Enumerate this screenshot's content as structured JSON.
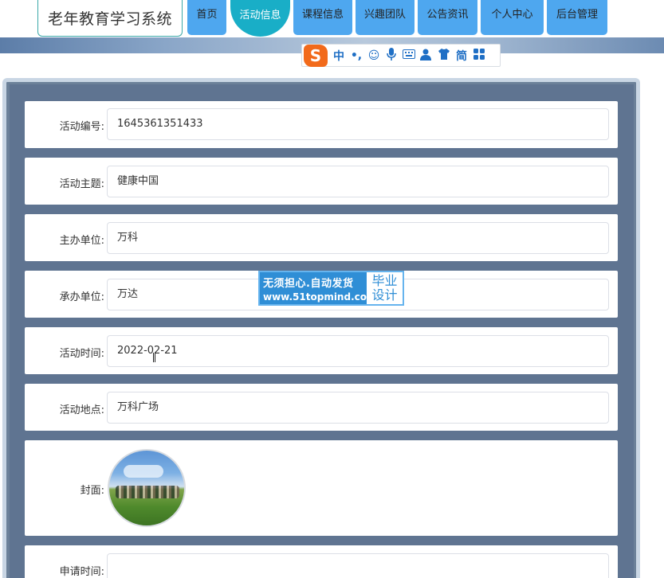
{
  "header": {
    "logo_text": "老年教育学习系统",
    "nav": [
      {
        "label": "首页"
      },
      {
        "label": "活动信息"
      },
      {
        "label": "课程信息"
      },
      {
        "label": "兴趣团队"
      },
      {
        "label": "公告资讯"
      },
      {
        "label": "个人中心"
      },
      {
        "label": "后台管理"
      }
    ]
  },
  "ime_toolbar": {
    "logo": "S",
    "buttons": [
      "中",
      "•,",
      "☺",
      "mic-icon",
      "keyboard-icon",
      "user-icon",
      "shirt-icon",
      "简",
      "apps-icon"
    ],
    "chinese_label": "中",
    "punct_label": "•,",
    "simplified_label": "简"
  },
  "form": {
    "fields": [
      {
        "label": "活动编号:",
        "value": "1645361351433"
      },
      {
        "label": "活动主题:",
        "value": "健康中国"
      },
      {
        "label": "主办单位:",
        "value": "万科"
      },
      {
        "label": "承办单位:",
        "value": "万达"
      },
      {
        "label": "活动时间:",
        "value": "2022-02-21"
      },
      {
        "label": "活动地点:",
        "value": "万科广场"
      }
    ],
    "cover_label": "封面:",
    "apply_time_label": "申请时间:",
    "apply_time_value": ""
  },
  "watermark": {
    "line1": "无须担心.自动发货",
    "line2": "www.51topmind.com",
    "right_top": "毕业",
    "right_bottom": "设计"
  },
  "colors": {
    "nav_blue": "#4ea7ef",
    "nav_active": "#19aec7",
    "panel_bg": "#5f7491",
    "watermark_blue": "#2f8ed6"
  }
}
